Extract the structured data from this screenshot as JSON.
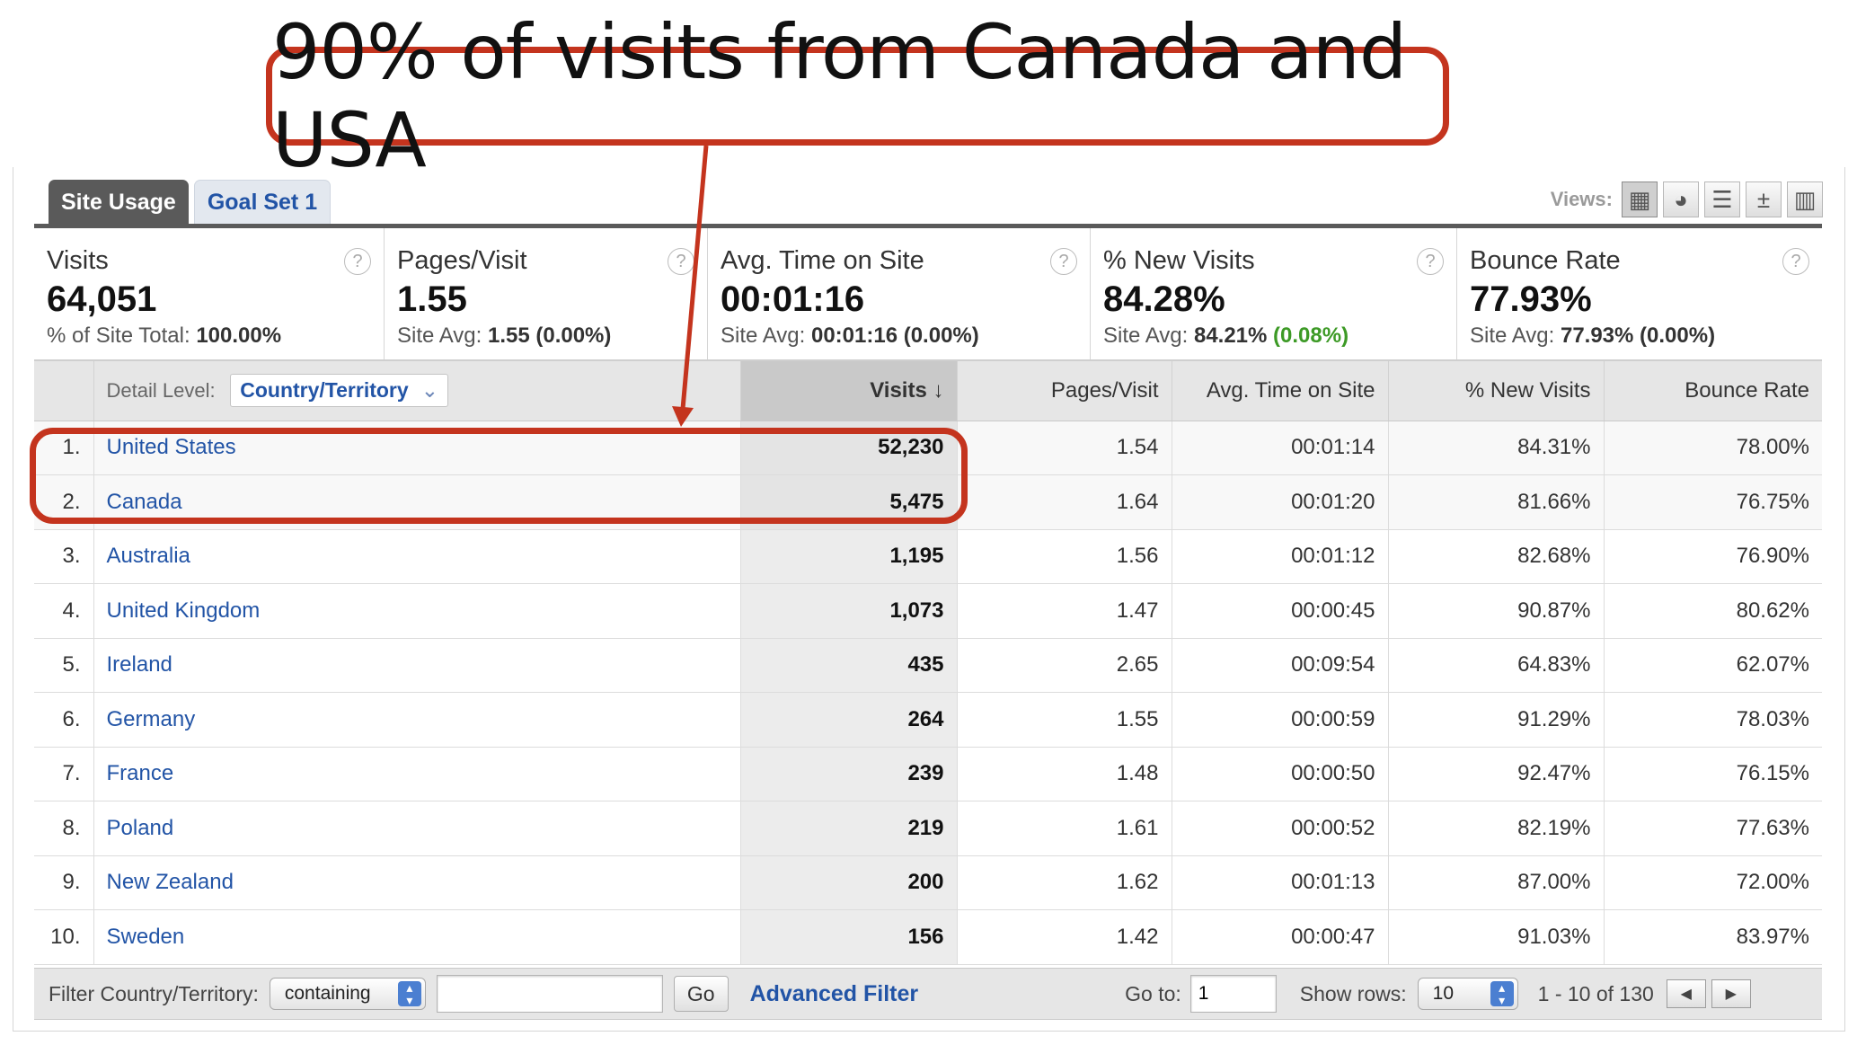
{
  "callout": {
    "text": "90% of visits from Canada and USA"
  },
  "tabs": [
    {
      "label": "Site Usage",
      "active": true
    },
    {
      "label": "Goal Set 1",
      "active": false
    }
  ],
  "views": {
    "label": "Views:",
    "buttons": [
      "table-view-icon",
      "pie-view-icon",
      "performance-view-icon",
      "comparison-view-icon",
      "pivot-view-icon"
    ]
  },
  "scorecards": [
    {
      "label": "Visits",
      "value": "64,051",
      "sub_prefix": "% of Site Total: ",
      "sub_value": "100.00%",
      "sub_delta": ""
    },
    {
      "label": "Pages/Visit",
      "value": "1.55",
      "sub_prefix": "Site Avg: ",
      "sub_value": "1.55",
      "sub_delta": " (0.00%)"
    },
    {
      "label": "Avg. Time on Site",
      "value": "00:01:16",
      "sub_prefix": "Site Avg: ",
      "sub_value": "00:01:16",
      "sub_delta": " (0.00%)"
    },
    {
      "label": "% New Visits",
      "value": "84.28%",
      "sub_prefix": "Site Avg: ",
      "sub_value": "84.21%",
      "sub_delta": " (0.08%)"
    },
    {
      "label": "Bounce Rate",
      "value": "77.93%",
      "sub_prefix": "Site Avg: ",
      "sub_value": "77.93%",
      "sub_delta": " (0.00%)"
    }
  ],
  "help_icon": "?",
  "table": {
    "detail_label": "Detail Level:",
    "detail_value": "Country/Territory",
    "detail_chevron": "⌄",
    "columns": [
      "Visits",
      "Pages/Visit",
      "Avg. Time on Site",
      "% New Visits",
      "Bounce Rate"
    ],
    "sort_arrow": "↓",
    "rows": [
      {
        "rank": "1.",
        "country": "United States",
        "visits": "52,230",
        "pages": "1.54",
        "time": "00:01:14",
        "new": "84.31%",
        "bounce": "78.00%"
      },
      {
        "rank": "2.",
        "country": "Canada",
        "visits": "5,475",
        "pages": "1.64",
        "time": "00:01:20",
        "new": "81.66%",
        "bounce": "76.75%"
      },
      {
        "rank": "3.",
        "country": "Australia",
        "visits": "1,195",
        "pages": "1.56",
        "time": "00:01:12",
        "new": "82.68%",
        "bounce": "76.90%"
      },
      {
        "rank": "4.",
        "country": "United Kingdom",
        "visits": "1,073",
        "pages": "1.47",
        "time": "00:00:45",
        "new": "90.87%",
        "bounce": "80.62%"
      },
      {
        "rank": "5.",
        "country": "Ireland",
        "visits": "435",
        "pages": "2.65",
        "time": "00:09:54",
        "new": "64.83%",
        "bounce": "62.07%"
      },
      {
        "rank": "6.",
        "country": "Germany",
        "visits": "264",
        "pages": "1.55",
        "time": "00:00:59",
        "new": "91.29%",
        "bounce": "78.03%"
      },
      {
        "rank": "7.",
        "country": "France",
        "visits": "239",
        "pages": "1.48",
        "time": "00:00:50",
        "new": "92.47%",
        "bounce": "76.15%"
      },
      {
        "rank": "8.",
        "country": "Poland",
        "visits": "219",
        "pages": "1.61",
        "time": "00:00:52",
        "new": "82.19%",
        "bounce": "77.63%"
      },
      {
        "rank": "9.",
        "country": "New Zealand",
        "visits": "200",
        "pages": "1.62",
        "time": "00:01:13",
        "new": "87.00%",
        "bounce": "72.00%"
      },
      {
        "rank": "10.",
        "country": "Sweden",
        "visits": "156",
        "pages": "1.42",
        "time": "00:00:47",
        "new": "91.03%",
        "bounce": "83.97%"
      }
    ]
  },
  "footer": {
    "filter_label": "Filter Country/Territory:",
    "filter_mode": "containing",
    "filter_value": "",
    "go_label": "Go",
    "advanced_label": "Advanced Filter",
    "goto_label": "Go to:",
    "goto_value": "1",
    "show_rows_label": "Show rows:",
    "show_rows_value": "10",
    "range_text": "1 - 10 of 130",
    "prev_icon": "◀",
    "next_icon": "▶"
  },
  "colors": {
    "annotation": "#c4341e",
    "link": "#2254a6",
    "positive": "#3d9a26"
  }
}
